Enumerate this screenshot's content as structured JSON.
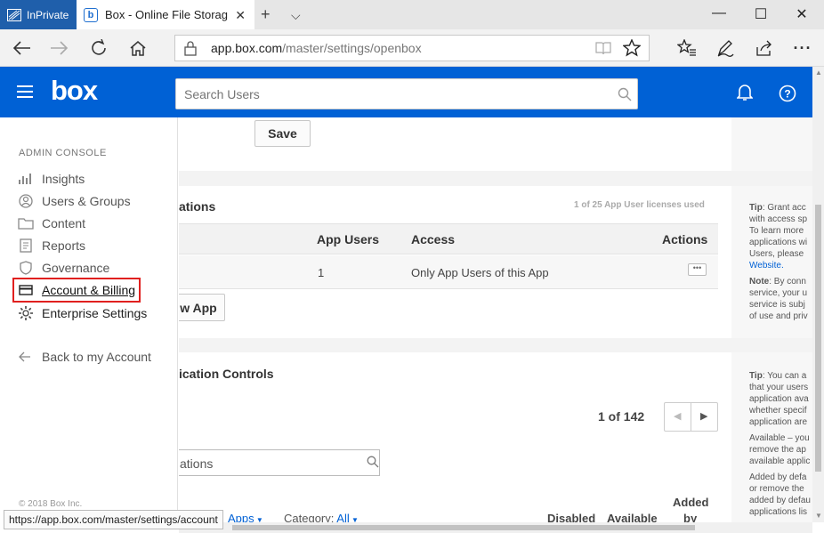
{
  "browser": {
    "inprivate_label": "InPrivate",
    "tab_title": "Box - Online File Storag",
    "url_host": "app.box.com",
    "url_path": "/master/settings/openbox",
    "status_url": "https://app.box.com/master/settings/account"
  },
  "header": {
    "logo": "box",
    "search_placeholder": "Search Users"
  },
  "sidebar": {
    "heading": "ADMIN CONSOLE",
    "items": [
      {
        "label": "Insights",
        "icon": "bar-chart-icon"
      },
      {
        "label": "Users & Groups",
        "icon": "user-icon"
      },
      {
        "label": "Content",
        "icon": "folder-icon"
      },
      {
        "label": "Reports",
        "icon": "report-icon"
      },
      {
        "label": "Governance",
        "icon": "shield-icon"
      },
      {
        "label": "Account & Billing",
        "icon": "credit-card-icon"
      },
      {
        "label": "Enterprise Settings",
        "icon": "gear-icon"
      }
    ],
    "back_label": "Back to my Account",
    "copyright": "© 2018 Box Inc."
  },
  "main": {
    "save_label": "Save",
    "section1": {
      "title": "ations",
      "license_text": "1 of 25 App User licenses used",
      "columns": [
        "App Users",
        "Access",
        "Actions"
      ],
      "row": {
        "app_users": "1",
        "access": "Only App Users of this App"
      },
      "new_app_label": "w App"
    },
    "section1_tip": {
      "lines": [
        "Grant acc",
        "with access sp",
        "To learn more",
        "applications wi",
        "Users, please",
        "Website."
      ],
      "tip_label": "Tip",
      "note_label": "Note",
      "note_lines": [
        "By conn",
        "service, your u",
        "service is subj",
        "of use and priv"
      ]
    },
    "section2": {
      "title": "ication Controls",
      "pagination": "1 of 142",
      "filter_value": "ations",
      "filter_apps_label": "Apps",
      "category_label": "Category:",
      "category_value": "All",
      "columns": [
        "Disabled",
        "Available",
        "Added",
        "by"
      ]
    },
    "section2_tip": {
      "tip_label": "Tip",
      "lines": [
        "You can a",
        "that your users",
        "application ava",
        "whether specif",
        "application are",
        "",
        "Available – you",
        "remove the ap",
        "available applic",
        "",
        "Added by defa",
        "or remove the",
        "added by defau",
        "applications lis"
      ]
    }
  }
}
